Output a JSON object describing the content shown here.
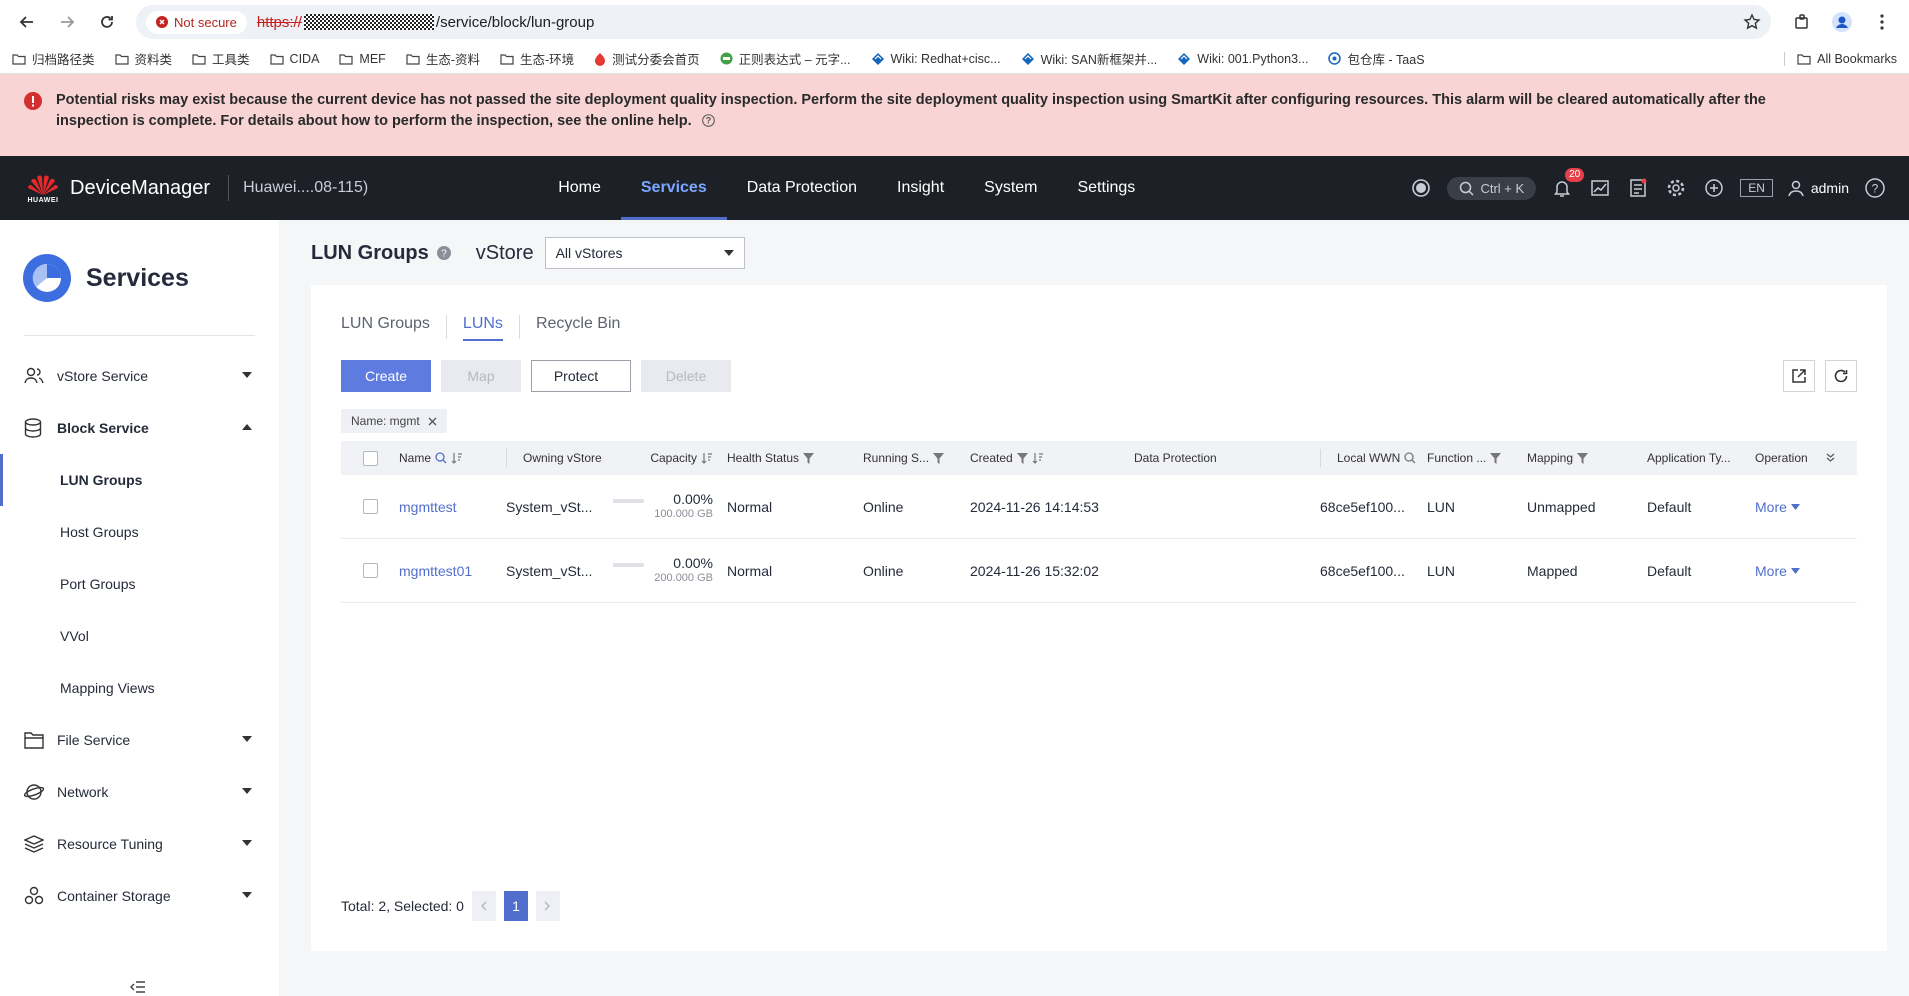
{
  "browser": {
    "security_label": "Not secure",
    "url_scheme": "https://",
    "url_path": "/service/block/lun-group",
    "bookmarks": [
      "归档路径类",
      "资料类",
      "工具类",
      "CIDA",
      "MEF",
      "生态-资料",
      "生态-环境",
      "测试分委会首页",
      "正则表达式 – 元字...",
      "Wiki: Redhat+cisc...",
      "Wiki: SAN新框架并...",
      "Wiki: 001.Python3...",
      "包仓库 - TaaS"
    ],
    "all_bookmarks": "All Bookmarks"
  },
  "alarm": {
    "text": "Potential risks may exist because the current device has not passed the site deployment quality inspection. Perform the site deployment quality inspection using SmartKit after configuring resources. This alarm will be cleared automatically after the inspection is complete. For details about how to perform the inspection, see the online help."
  },
  "topnav": {
    "vendor": "HUAWEI",
    "brand": "DeviceManager",
    "device": "Huawei....08-115)",
    "menu": [
      "Home",
      "Services",
      "Data Protection",
      "Insight",
      "System",
      "Settings"
    ],
    "active_menu": "Services",
    "search_hint": "Ctrl + K",
    "notification_count": "20",
    "lang": "EN",
    "user": "admin"
  },
  "sidebar": {
    "title": "Services",
    "items": [
      {
        "label": "vStore Service",
        "icon": "users-icon"
      },
      {
        "label": "Block Service",
        "icon": "database-icon"
      },
      {
        "label": "File Service",
        "icon": "folder-icon"
      },
      {
        "label": "Network",
        "icon": "globe-icon"
      },
      {
        "label": "Resource Tuning",
        "icon": "layers-icon"
      },
      {
        "label": "Container Storage",
        "icon": "container-icon"
      }
    ],
    "block_sub": [
      "LUN Groups",
      "Host Groups",
      "Port Groups",
      "VVol",
      "Mapping Views"
    ],
    "active_sub": "LUN Groups"
  },
  "page": {
    "title": "LUN Groups",
    "vstore_label": "vStore",
    "vstore_value": "All vStores",
    "tabs": [
      "LUN Groups",
      "LUNs",
      "Recycle Bin"
    ],
    "active_tab": "LUNs",
    "toolbar": {
      "create": "Create",
      "map": "Map",
      "protect": "Protect",
      "delete": "Delete"
    },
    "filter_chip": "Name: mgmt"
  },
  "table": {
    "columns": [
      "Name",
      "Owning vStore",
      "Capacity",
      "Health Status",
      "Running S...",
      "Created",
      "Data Protection",
      "Local WWN",
      "Function ...",
      "Mapping",
      "Application Ty...",
      "Operation"
    ],
    "rows": [
      {
        "name": "mgmttest",
        "vstore": "System_vSt...",
        "capacity_pct": "0.00%",
        "capacity_used": 0.0,
        "capacity_size": "100.000 GB",
        "health": "Normal",
        "running": "Online",
        "created": "2024-11-26 14:14:53",
        "data_protection": "",
        "wwn": "68ce5ef100...",
        "function": "LUN",
        "mapping": "Unmapped",
        "app_type": "Default",
        "operation": "More"
      },
      {
        "name": "mgmttest01",
        "vstore": "System_vSt...",
        "capacity_pct": "0.00%",
        "capacity_used": 0.0,
        "capacity_size": "200.000 GB",
        "health": "Normal",
        "running": "Online",
        "created": "2024-11-26 15:32:02",
        "data_protection": "",
        "wwn": "68ce5ef100...",
        "function": "LUN",
        "mapping": "Mapped",
        "app_type": "Default",
        "operation": "More"
      }
    ]
  },
  "pager": {
    "summary": "Total: 2, Selected: 0",
    "current": "1"
  },
  "colors": {
    "accent": "#526ecc",
    "primary_button": "#5e7ce0",
    "alarm_bg": "#f8d4d4",
    "nav_bg": "#1d2027"
  }
}
